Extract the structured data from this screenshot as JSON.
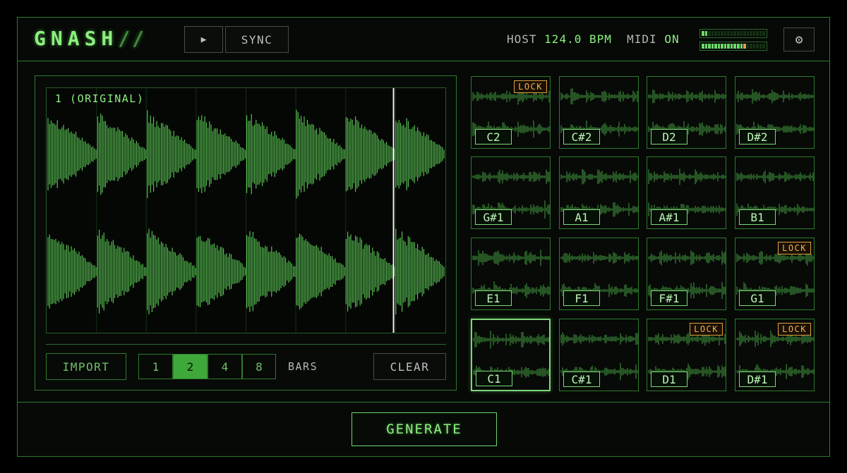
{
  "app": {
    "logo": "GNASH",
    "logo_suffix": "//"
  },
  "header": {
    "play_icon": "play-icon",
    "play_glyph": "▶",
    "sync_label": "SYNC",
    "host_label": "HOST",
    "tempo": "124.0 BPM",
    "midi_label": "MIDI",
    "midi_state": "ON",
    "meter_top_level": 0.1,
    "meter_bottom_level": 0.7,
    "settings_glyph": "⚙"
  },
  "waveform": {
    "label": "1 (ORIGINAL)",
    "playhead_position": 0.87
  },
  "controls": {
    "import_label": "IMPORT",
    "bars_options": [
      "1",
      "2",
      "4",
      "8"
    ],
    "bars_selected": "2",
    "bars_label": "BARS",
    "clear_label": "CLEAR"
  },
  "pads": [
    {
      "note": "C2",
      "lock": "LOCK"
    },
    {
      "note": "C#2"
    },
    {
      "note": "D2"
    },
    {
      "note": "D#2"
    },
    {
      "note": "G#1"
    },
    {
      "note": "A1"
    },
    {
      "note": "A#1"
    },
    {
      "note": "B1"
    },
    {
      "note": "E1"
    },
    {
      "note": "F1"
    },
    {
      "note": "F#1"
    },
    {
      "note": "G1",
      "lock": "LOCK"
    },
    {
      "note": "C1",
      "selected": true
    },
    {
      "note": "C#1"
    },
    {
      "note": "D1",
      "lock": "LOCK"
    },
    {
      "note": "D#1",
      "lock": "LOCK"
    }
  ],
  "generate_label": "GENERATE",
  "colors": {
    "accent": "#7ee07a",
    "lock": "#f0b050",
    "border": "#2f7a2f"
  }
}
